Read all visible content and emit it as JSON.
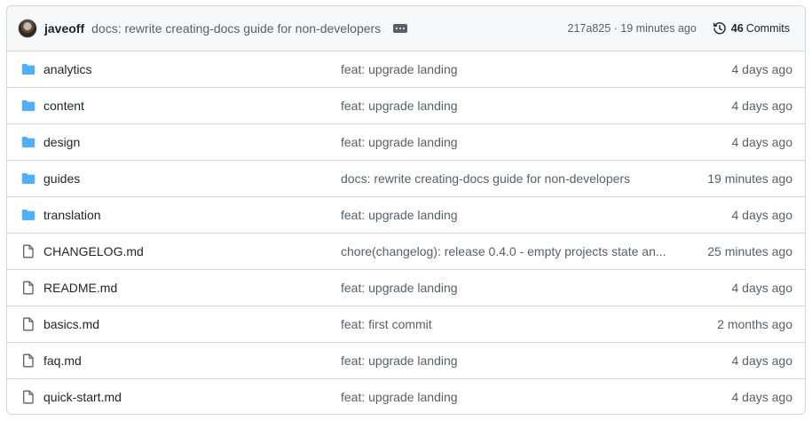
{
  "header": {
    "author": "javeoff",
    "message": "docs: rewrite creating-docs guide for non-developers",
    "sha_time": "217a825 · 19 minutes ago",
    "commit_count": "46",
    "commits_label": "Commits"
  },
  "colors": {
    "folder": "#54aeff",
    "text": "#1f2328",
    "muted": "#57606a",
    "border": "#d0d7de"
  },
  "rows": [
    {
      "type": "folder",
      "name": "analytics",
      "message": "feat: upgrade landing",
      "date": "4 days ago"
    },
    {
      "type": "folder",
      "name": "content",
      "message": "feat: upgrade landing",
      "date": "4 days ago"
    },
    {
      "type": "folder",
      "name": "design",
      "message": "feat: upgrade landing",
      "date": "4 days ago"
    },
    {
      "type": "folder",
      "name": "guides",
      "message": "docs: rewrite creating-docs guide for non-developers",
      "date": "19 minutes ago"
    },
    {
      "type": "folder",
      "name": "translation",
      "message": "feat: upgrade landing",
      "date": "4 days ago"
    },
    {
      "type": "file",
      "name": "CHANGELOG.md",
      "message": "chore(changelog): release 0.4.0 - empty projects state an...",
      "date": "25 minutes ago"
    },
    {
      "type": "file",
      "name": "README.md",
      "message": "feat: upgrade landing",
      "date": "4 days ago"
    },
    {
      "type": "file",
      "name": "basics.md",
      "message": "feat: first commit",
      "date": "2 months ago"
    },
    {
      "type": "file",
      "name": "faq.md",
      "message": "feat: upgrade landing",
      "date": "4 days ago"
    },
    {
      "type": "file",
      "name": "quick-start.md",
      "message": "feat: upgrade landing",
      "date": "4 days ago"
    }
  ]
}
